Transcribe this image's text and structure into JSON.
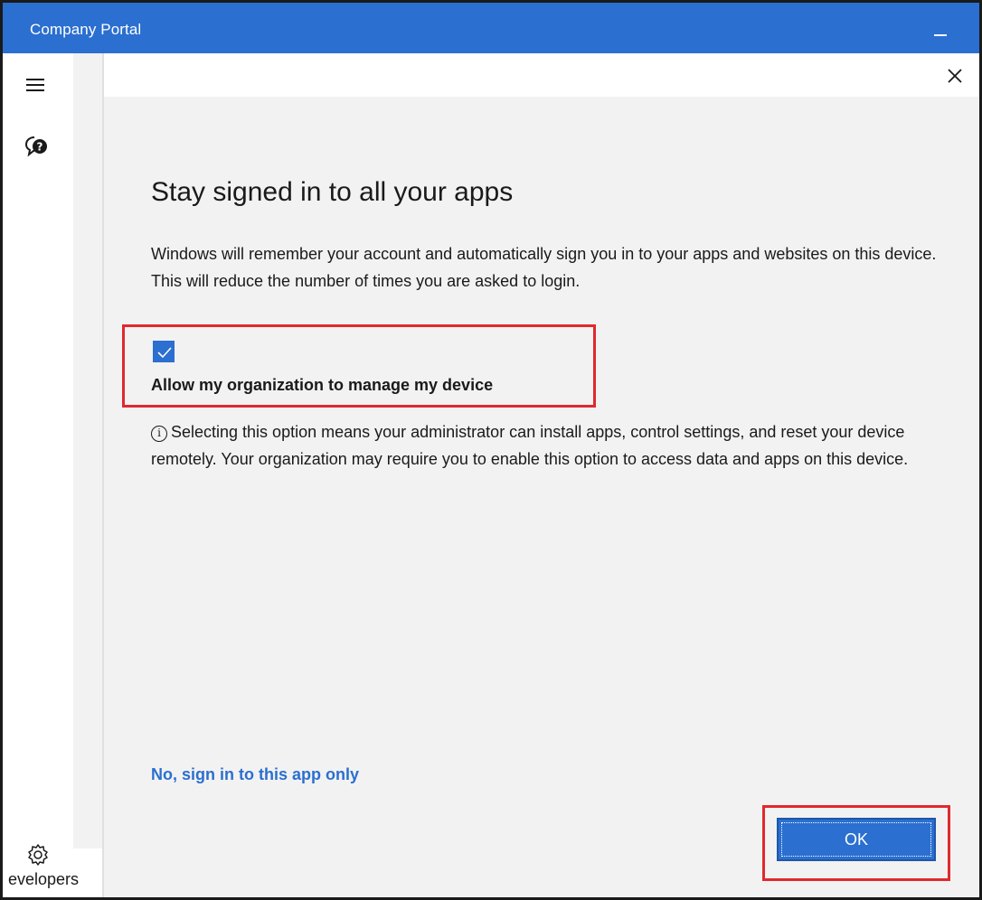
{
  "window": {
    "title": "Company Portal"
  },
  "sidebar": {
    "footer_text": "evelopers"
  },
  "dialog": {
    "heading": "Stay signed in to all your apps",
    "description": "Windows will remember your account and automatically sign you in to your apps and websites on this device. This will reduce the number of times you are asked to login.",
    "checkbox": {
      "label": "Allow my organization to manage my device",
      "checked": true
    },
    "info_text": "Selecting this option means your administrator can install apps, control settings, and reset your device remotely. Your organization may require you to enable this option to access data and apps on this device.",
    "alt_link": "No, sign in to this app only",
    "ok_label": "OK"
  },
  "icons": {
    "menu": "hamburger-icon",
    "help": "help-icon",
    "settings": "gear-icon",
    "close": "close-icon",
    "info": "info-icon"
  },
  "colors": {
    "accent": "#2b6fd0",
    "highlight": "#e0292d",
    "dialog_bg": "#f2f2f2"
  }
}
